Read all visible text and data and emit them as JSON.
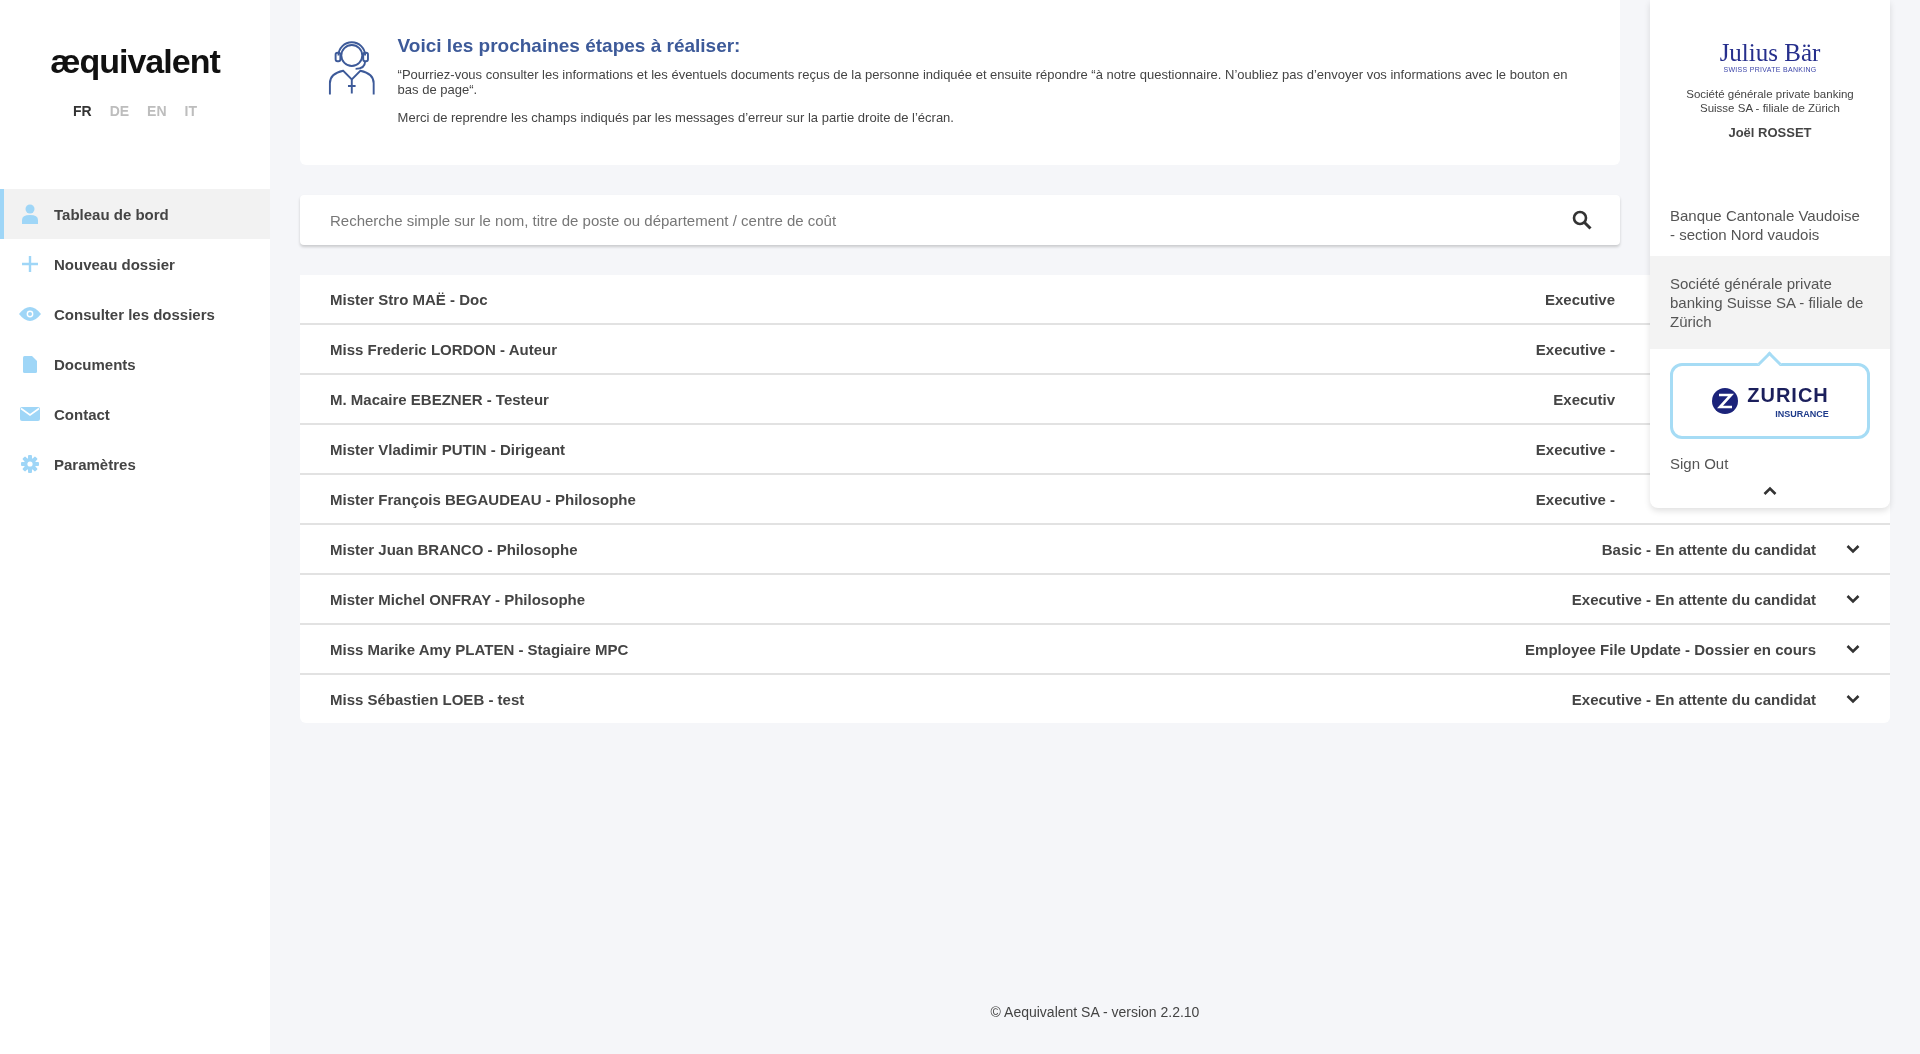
{
  "brand": {
    "logo": "æquivalent"
  },
  "languages": [
    {
      "code": "FR",
      "selected": true
    },
    {
      "code": "DE",
      "selected": false
    },
    {
      "code": "EN",
      "selected": false
    },
    {
      "code": "IT",
      "selected": false
    }
  ],
  "nav": [
    {
      "label": "Tableau de bord",
      "selected": true
    },
    {
      "label": "Nouveau dossier",
      "selected": false
    },
    {
      "label": "Consulter les dossiers",
      "selected": false
    },
    {
      "label": "Documents",
      "selected": false
    },
    {
      "label": "Contact",
      "selected": false
    },
    {
      "label": "Paramètres",
      "selected": false
    }
  ],
  "notice": {
    "title": "Voici les prochaines étapes à réaliser:",
    "paragraphs": [
      "“Pourriez-vous consulter les informations et les éventuels documents reçus de la personne indiquée et ensuite répondre “à notre questionnaire. N’oubliez pas d’envoyer vos informations avec le bouton en bas de page“.",
      "Merci de reprendre les champs indiqués par les messages d’erreur sur la partie droite de l’écran."
    ]
  },
  "search": {
    "placeholder": "Recherche simple sur le nom, titre de poste ou département / centre de coût"
  },
  "files": [
    {
      "name": "Mister Stro MAË - Doc",
      "status": "Executive",
      "covered": true
    },
    {
      "name": "Miss Frederic LORDON - Auteur",
      "status": "Executive -",
      "covered": true
    },
    {
      "name": "M. Macaire EBEZNER - Testeur",
      "status": "Executiv",
      "covered": true
    },
    {
      "name": "Mister Vladimir PUTIN - Dirigeant",
      "status": "Executive -",
      "covered": true
    },
    {
      "name": "Mister François BEGAUDEAU - Philosophe",
      "status": "Executive -",
      "covered": true
    },
    {
      "name": "Mister Juan BRANCO - Philosophe",
      "status": "Basic - En attente du candidat",
      "covered": false
    },
    {
      "name": "Mister Michel ONFRAY - Philosophe",
      "status": "Executive - En attente du candidat",
      "covered": false
    },
    {
      "name": "Miss Marike Amy PLATEN - Stagiaire MPC",
      "status": "Employee File Update - Dossier en cours",
      "covered": false
    },
    {
      "name": "Miss Sébastien LOEB - test",
      "status": "Executive - En attente du candidat",
      "covered": false
    }
  ],
  "account_menu": {
    "company_logo": {
      "name": "Julius Bär",
      "tagline": "SWISS PRIVATE BANKING"
    },
    "company": "Société générale private banking Suisse SA - filiale de Zürich",
    "user": "Joël ROSSET",
    "items": [
      {
        "label": "Banque Cantonale Vaudoise - section Nord vaudois",
        "selected": false
      },
      {
        "label": "Société générale private banking Suisse SA - filiale de Zürich",
        "selected": true
      }
    ],
    "tooltip_logo": {
      "name": "ZURICH",
      "tagline": "INSURANCE"
    },
    "sign_out": "Sign Out"
  },
  "footer": "© Aequivalent SA - version 2.2.10"
}
